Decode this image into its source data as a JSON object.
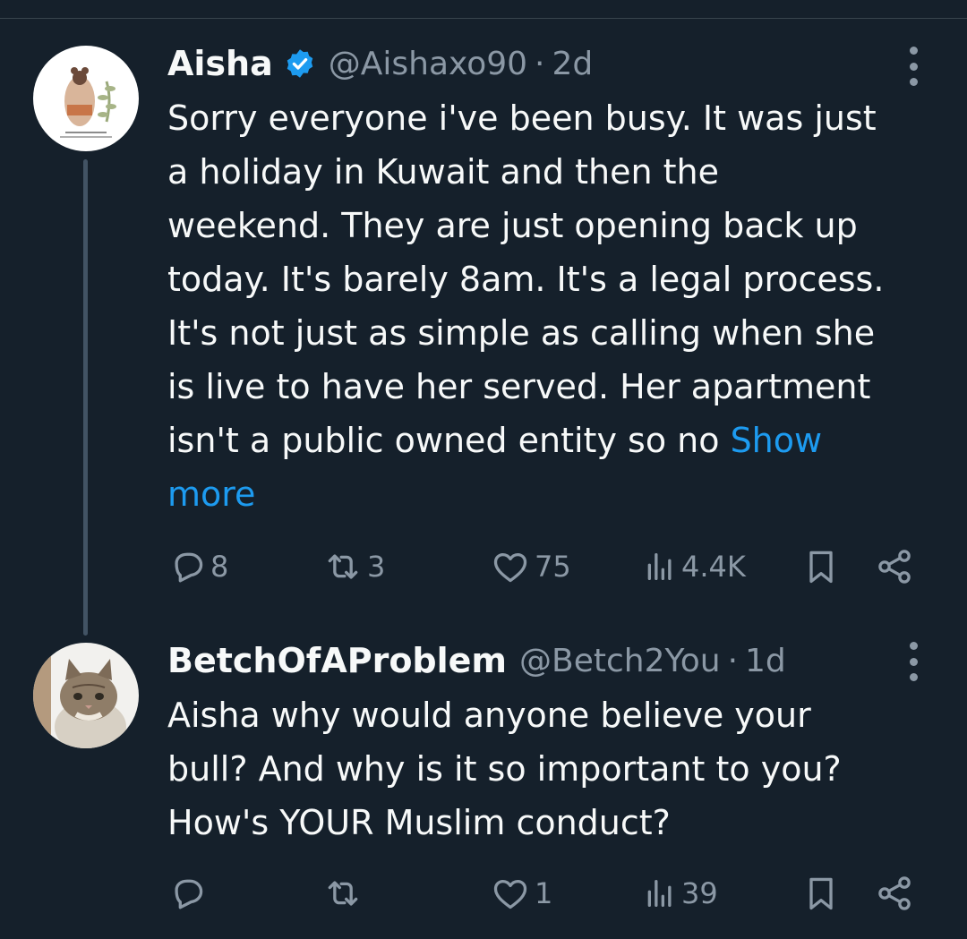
{
  "tweets": [
    {
      "name": "Aisha",
      "verified": true,
      "handle": "@Aishaxo90",
      "separator": "·",
      "time": "2d",
      "text": "Sorry everyone i've been busy. It was just\na holiday in Kuwait and then the\nweekend. They are just opening back up\ntoday. It's barely 8am. It's a legal process.\nIt's not just as simple as calling when she\nis live to have her served. Her apartment\nisn't a public owned entity so no ",
      "show_more": "Show\nmore",
      "replies": "8",
      "reposts": "3",
      "likes": "75",
      "views": "4.4K"
    },
    {
      "name": "BetchOfAProblem",
      "verified": false,
      "handle": "@Betch2You",
      "separator": "·",
      "time": "1d",
      "text": "Aisha why would anyone believe your\nbull? And why is it so important to you?\nHow's YOUR Muslim conduct?",
      "views": "39",
      "likes": "1"
    }
  ],
  "icons": {
    "reply": "reply-icon",
    "repost": "repost-icon",
    "like": "heart-icon",
    "views": "views-icon",
    "bookmark": "bookmark-icon",
    "share": "share-icon",
    "more": "more-vertical-icon",
    "verified": "verified-badge-icon"
  },
  "colors": {
    "background": "#15202b",
    "text": "#f7f9f9",
    "muted": "#8b98a5",
    "link": "#1d9bf0",
    "thread_line": "#425364"
  }
}
